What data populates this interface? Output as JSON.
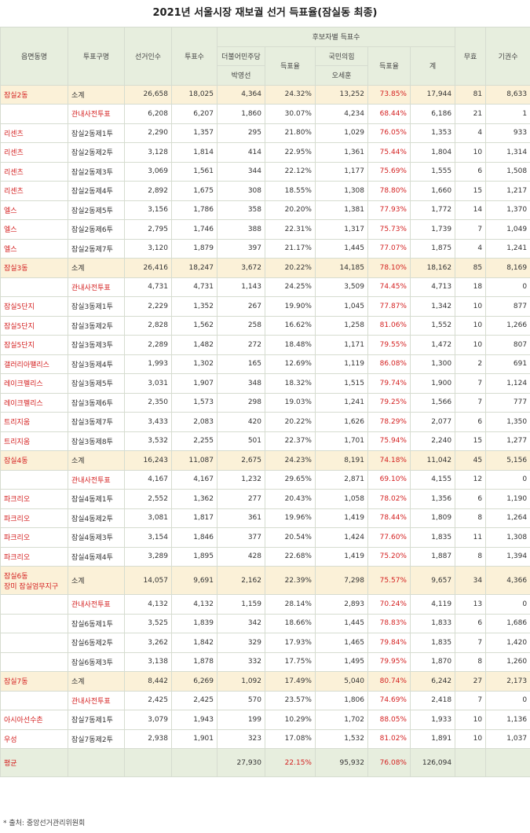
{
  "title": "2021년 서울시장 재보궐 선거 득표율(잠실동 최종)",
  "headers": {
    "dong": "읍면동명",
    "gubun": "투표구명",
    "electors": "선거인수",
    "votes": "투표수",
    "group": "후보자별 득표수",
    "c1_party": "더불어민주당",
    "c1_name": "박영선",
    "rate1": "득표율",
    "c2_party": "국민의힘",
    "c2_name": "오세훈",
    "rate2": "득표율",
    "total": "계",
    "invalid": "무효",
    "abstain": "기권수"
  },
  "rows": [
    {
      "type": "sub",
      "dong": "잠실2동",
      "gubun": "소계",
      "electors": "26,658",
      "votes": "18,025",
      "c1": "4,364",
      "r1": "24.32%",
      "c2": "13,252",
      "r2": "73.85%",
      "total": "17,944",
      "invalid": "81",
      "abstain": "8,633"
    },
    {
      "type": "pre",
      "dong": "",
      "gubun": "관내사전투표",
      "electors": "6,208",
      "votes": "6,207",
      "c1": "1,860",
      "r1": "30.07%",
      "c2": "4,234",
      "r2": "68.44%",
      "total": "6,186",
      "invalid": "21",
      "abstain": "1"
    },
    {
      "type": "row",
      "dong": "리센츠",
      "gubun": "잠실2동제1투",
      "electors": "2,290",
      "votes": "1,357",
      "c1": "295",
      "r1": "21.80%",
      "c2": "1,029",
      "r2": "76.05%",
      "total": "1,353",
      "invalid": "4",
      "abstain": "933"
    },
    {
      "type": "row",
      "dong": "리센츠",
      "gubun": "잠실2동제2투",
      "electors": "3,128",
      "votes": "1,814",
      "c1": "414",
      "r1": "22.95%",
      "c2": "1,361",
      "r2": "75.44%",
      "total": "1,804",
      "invalid": "10",
      "abstain": "1,314"
    },
    {
      "type": "row",
      "dong": "리센츠",
      "gubun": "잠실2동제3투",
      "electors": "3,069",
      "votes": "1,561",
      "c1": "344",
      "r1": "22.12%",
      "c2": "1,177",
      "r2": "75.69%",
      "total": "1,555",
      "invalid": "6",
      "abstain": "1,508"
    },
    {
      "type": "row",
      "dong": "리센츠",
      "gubun": "잠실2동제4투",
      "electors": "2,892",
      "votes": "1,675",
      "c1": "308",
      "r1": "18.55%",
      "c2": "1,308",
      "r2": "78.80%",
      "total": "1,660",
      "invalid": "15",
      "abstain": "1,217"
    },
    {
      "type": "row",
      "dong": "엘스",
      "gubun": "잠실2동제5투",
      "electors": "3,156",
      "votes": "1,786",
      "c1": "358",
      "r1": "20.20%",
      "c2": "1,381",
      "r2": "77.93%",
      "total": "1,772",
      "invalid": "14",
      "abstain": "1,370"
    },
    {
      "type": "row",
      "dong": "엘스",
      "gubun": "잠실2동제6투",
      "electors": "2,795",
      "votes": "1,746",
      "c1": "388",
      "r1": "22.31%",
      "c2": "1,317",
      "r2": "75.73%",
      "total": "1,739",
      "invalid": "7",
      "abstain": "1,049"
    },
    {
      "type": "row",
      "dong": "엘스",
      "gubun": "잠실2동제7투",
      "electors": "3,120",
      "votes": "1,879",
      "c1": "397",
      "r1": "21.17%",
      "c2": "1,445",
      "r2": "77.07%",
      "total": "1,875",
      "invalid": "4",
      "abstain": "1,241"
    },
    {
      "type": "sub",
      "dong": "잠실3동",
      "gubun": "소계",
      "electors": "26,416",
      "votes": "18,247",
      "c1": "3,672",
      "r1": "20.22%",
      "c2": "14,185",
      "r2": "78.10%",
      "total": "18,162",
      "invalid": "85",
      "abstain": "8,169"
    },
    {
      "type": "pre",
      "dong": "",
      "gubun": "관내사전투표",
      "electors": "4,731",
      "votes": "4,731",
      "c1": "1,143",
      "r1": "24.25%",
      "c2": "3,509",
      "r2": "74.45%",
      "total": "4,713",
      "invalid": "18",
      "abstain": "0"
    },
    {
      "type": "row",
      "dong": "잠실5단지",
      "gubun": "잠실3동제1투",
      "electors": "2,229",
      "votes": "1,352",
      "c1": "267",
      "r1": "19.90%",
      "c2": "1,045",
      "r2": "77.87%",
      "total": "1,342",
      "invalid": "10",
      "abstain": "877"
    },
    {
      "type": "row",
      "dong": "잠실5단지",
      "gubun": "잠실3동제2투",
      "electors": "2,828",
      "votes": "1,562",
      "c1": "258",
      "r1": "16.62%",
      "c2": "1,258",
      "r2": "81.06%",
      "total": "1,552",
      "invalid": "10",
      "abstain": "1,266"
    },
    {
      "type": "row",
      "dong": "잠실5단지",
      "gubun": "잠실3동제3투",
      "electors": "2,289",
      "votes": "1,482",
      "c1": "272",
      "r1": "18.48%",
      "c2": "1,171",
      "r2": "79.55%",
      "total": "1,472",
      "invalid": "10",
      "abstain": "807"
    },
    {
      "type": "row",
      "dong": "갤러리아팰리스",
      "gubun": "잠실3동제4투",
      "electors": "1,993",
      "votes": "1,302",
      "c1": "165",
      "r1": "12.69%",
      "c2": "1,119",
      "r2": "86.08%",
      "total": "1,300",
      "invalid": "2",
      "abstain": "691"
    },
    {
      "type": "row",
      "dong": "레이크펠리스",
      "gubun": "잠실3동제5투",
      "electors": "3,031",
      "votes": "1,907",
      "c1": "348",
      "r1": "18.32%",
      "c2": "1,515",
      "r2": "79.74%",
      "total": "1,900",
      "invalid": "7",
      "abstain": "1,124"
    },
    {
      "type": "row",
      "dong": "레이크펠리스",
      "gubun": "잠실3동제6투",
      "electors": "2,350",
      "votes": "1,573",
      "c1": "298",
      "r1": "19.03%",
      "c2": "1,241",
      "r2": "79.25%",
      "total": "1,566",
      "invalid": "7",
      "abstain": "777"
    },
    {
      "type": "row",
      "dong": "트리지움",
      "gubun": "잠실3동제7투",
      "electors": "3,433",
      "votes": "2,083",
      "c1": "420",
      "r1": "20.22%",
      "c2": "1,626",
      "r2": "78.29%",
      "total": "2,077",
      "invalid": "6",
      "abstain": "1,350"
    },
    {
      "type": "row",
      "dong": "트리지움",
      "gubun": "잠실3동제8투",
      "electors": "3,532",
      "votes": "2,255",
      "c1": "501",
      "r1": "22.37%",
      "c2": "1,701",
      "r2": "75.94%",
      "total": "2,240",
      "invalid": "15",
      "abstain": "1,277"
    },
    {
      "type": "sub",
      "dong": "잠실4동",
      "gubun": "소계",
      "electors": "16,243",
      "votes": "11,087",
      "c1": "2,675",
      "r1": "24.23%",
      "c2": "8,191",
      "r2": "74.18%",
      "total": "11,042",
      "invalid": "45",
      "abstain": "5,156"
    },
    {
      "type": "pre",
      "dong": "",
      "gubun": "관내사전투표",
      "electors": "4,167",
      "votes": "4,167",
      "c1": "1,232",
      "r1": "29.65%",
      "c2": "2,871",
      "r2": "69.10%",
      "total": "4,155",
      "invalid": "12",
      "abstain": "0"
    },
    {
      "type": "row",
      "dong": "파크리오",
      "gubun": "잠실4동제1투",
      "electors": "2,552",
      "votes": "1,362",
      "c1": "277",
      "r1": "20.43%",
      "c2": "1,058",
      "r2": "78.02%",
      "total": "1,356",
      "invalid": "6",
      "abstain": "1,190"
    },
    {
      "type": "row",
      "dong": "파크리오",
      "gubun": "잠실4동제2투",
      "electors": "3,081",
      "votes": "1,817",
      "c1": "361",
      "r1": "19.96%",
      "c2": "1,419",
      "r2": "78.44%",
      "total": "1,809",
      "invalid": "8",
      "abstain": "1,264"
    },
    {
      "type": "row",
      "dong": "파크리오",
      "gubun": "잠실4동제3투",
      "electors": "3,154",
      "votes": "1,846",
      "c1": "377",
      "r1": "20.54%",
      "c2": "1,424",
      "r2": "77.60%",
      "total": "1,835",
      "invalid": "11",
      "abstain": "1,308"
    },
    {
      "type": "row",
      "dong": "파크리오",
      "gubun": "잠실4동제4투",
      "electors": "3,289",
      "votes": "1,895",
      "c1": "428",
      "r1": "22.68%",
      "c2": "1,419",
      "r2": "75.20%",
      "total": "1,887",
      "invalid": "8",
      "abstain": "1,394"
    },
    {
      "type": "sub2",
      "dong": "잠실6동",
      "dong2": "장미 잠실엄무지구",
      "gubun": "소계",
      "electors": "14,057",
      "votes": "9,691",
      "c1": "2,162",
      "r1": "22.39%",
      "c2": "7,298",
      "r2": "75.57%",
      "total": "9,657",
      "invalid": "34",
      "abstain": "4,366"
    },
    {
      "type": "pre",
      "dong": "",
      "gubun": "관내사전투표",
      "electors": "4,132",
      "votes": "4,132",
      "c1": "1,159",
      "r1": "28.14%",
      "c2": "2,893",
      "r2": "70.24%",
      "total": "4,119",
      "invalid": "13",
      "abstain": "0"
    },
    {
      "type": "row",
      "dong": "",
      "gubun": "잠실6동제1투",
      "electors": "3,525",
      "votes": "1,839",
      "c1": "342",
      "r1": "18.66%",
      "c2": "1,445",
      "r2": "78.83%",
      "total": "1,833",
      "invalid": "6",
      "abstain": "1,686"
    },
    {
      "type": "row",
      "dong": "",
      "gubun": "잠실6동제2투",
      "electors": "3,262",
      "votes": "1,842",
      "c1": "329",
      "r1": "17.93%",
      "c2": "1,465",
      "r2": "79.84%",
      "total": "1,835",
      "invalid": "7",
      "abstain": "1,420"
    },
    {
      "type": "row",
      "dong": "",
      "gubun": "잠실6동제3투",
      "electors": "3,138",
      "votes": "1,878",
      "c1": "332",
      "r1": "17.75%",
      "c2": "1,495",
      "r2": "79.95%",
      "total": "1,870",
      "invalid": "8",
      "abstain": "1,260"
    },
    {
      "type": "sub",
      "dong": "잠실7동",
      "gubun": "소계",
      "electors": "8,442",
      "votes": "6,269",
      "c1": "1,092",
      "r1": "17.49%",
      "c2": "5,040",
      "r2": "80.74%",
      "total": "6,242",
      "invalid": "27",
      "abstain": "2,173"
    },
    {
      "type": "pre",
      "dong": "",
      "gubun": "관내사전투표",
      "electors": "2,425",
      "votes": "2,425",
      "c1": "570",
      "r1": "23.57%",
      "c2": "1,806",
      "r2": "74.69%",
      "total": "2,418",
      "invalid": "7",
      "abstain": "0"
    },
    {
      "type": "row",
      "dong": "아시아선수촌",
      "gubun": "잠실7동제1투",
      "electors": "3,079",
      "votes": "1,943",
      "c1": "199",
      "r1": "10.29%",
      "c2": "1,702",
      "r2": "88.05%",
      "total": "1,933",
      "invalid": "10",
      "abstain": "1,136"
    },
    {
      "type": "row",
      "dong": "우성",
      "gubun": "잠실7동제2투",
      "electors": "2,938",
      "votes": "1,901",
      "c1": "323",
      "r1": "17.08%",
      "c2": "1,532",
      "r2": "81.02%",
      "total": "1,891",
      "invalid": "10",
      "abstain": "1,037"
    }
  ],
  "average": {
    "label": "평균",
    "c1": "27,930",
    "r1": "22.15%",
    "c2": "95,932",
    "r2": "76.08%",
    "total": "126,094"
  },
  "footnote": "* 출처: 중앙선거관리위원회"
}
